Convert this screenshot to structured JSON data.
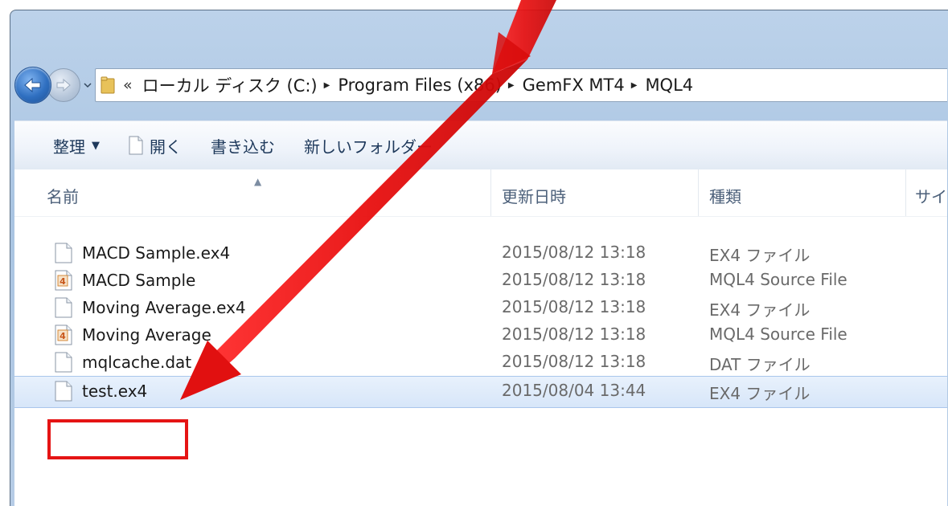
{
  "address_bar": {
    "chevrons": "«",
    "crumbs": [
      "ローカル ディスク (C:)",
      "Program Files (x86)",
      "GemFX MT4",
      "MQL4"
    ]
  },
  "toolbar": {
    "organize_label": "整理",
    "open_label": "開く",
    "burn_label": "書き込む",
    "new_folder_label": "新しいフォルダー"
  },
  "columns": {
    "name": "名前",
    "date": "更新日時",
    "type": "種類",
    "size": "サイ"
  },
  "files": [
    {
      "name": "MACD Sample.ex4",
      "date": "2015/08/12 13:18",
      "type": "EX4 ファイル",
      "icon": "blank-file-icon"
    },
    {
      "name": "MACD Sample",
      "date": "2015/08/12 13:18",
      "type": "MQL4 Source File",
      "icon": "mql4-file-icon"
    },
    {
      "name": "Moving Average.ex4",
      "date": "2015/08/12 13:18",
      "type": "EX4 ファイル",
      "icon": "blank-file-icon"
    },
    {
      "name": "Moving Average",
      "date": "2015/08/12 13:18",
      "type": "MQL4 Source File",
      "icon": "mql4-file-icon"
    },
    {
      "name": "mqlcache.dat",
      "date": "2015/08/12 13:18",
      "type": "DAT ファイル",
      "icon": "blank-file-icon"
    },
    {
      "name": "test.ex4",
      "date": "2015/08/04 13:44",
      "type": "EX4 ファイル",
      "icon": "blank-file-icon",
      "selected": true
    }
  ],
  "colors": {
    "annotation_red": "#e51414",
    "selection": "#d7e6f9",
    "toolbar_text": "#1e395b"
  }
}
